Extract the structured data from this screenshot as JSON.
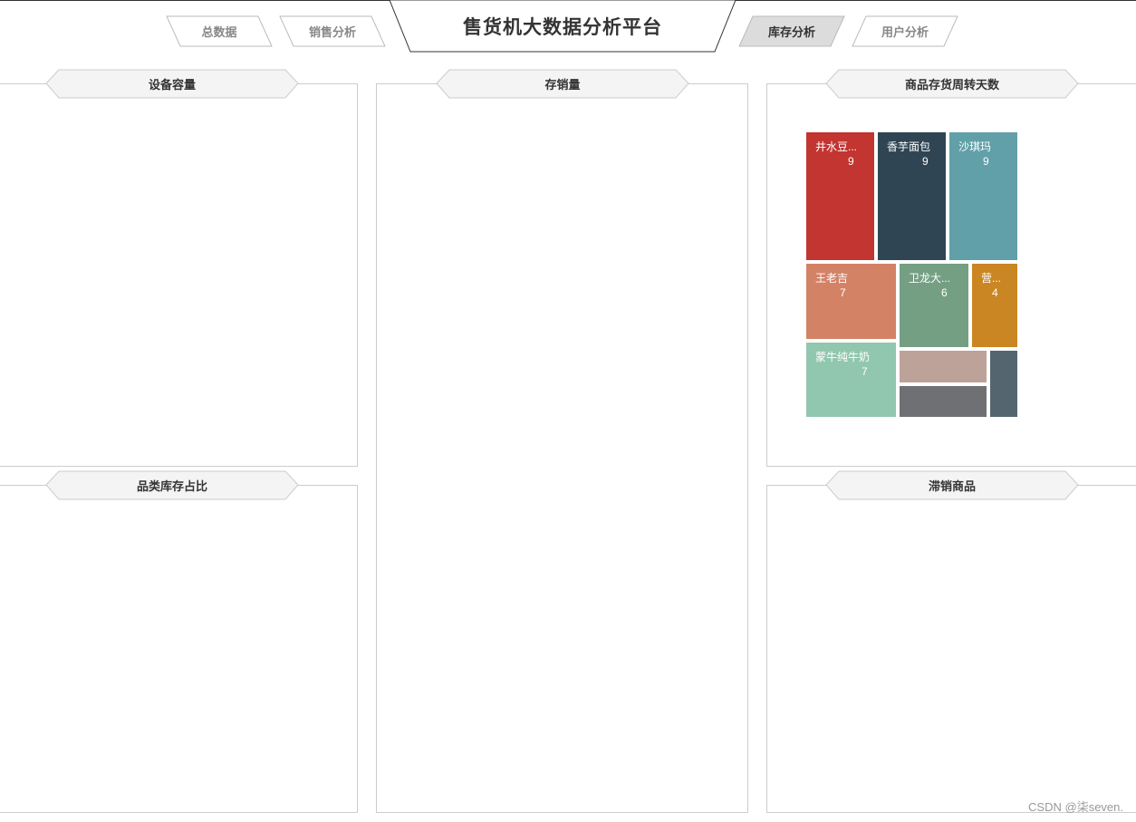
{
  "header": {
    "title": "售货机大数据分析平台",
    "nav": [
      {
        "label": "总数据",
        "active": false
      },
      {
        "label": "销售分析",
        "active": false
      },
      {
        "label": "库存分析",
        "active": true
      },
      {
        "label": "用户分析",
        "active": false
      }
    ]
  },
  "panels": {
    "device_capacity": {
      "title": "设备容量"
    },
    "category_stock": {
      "title": "品类库存占比"
    },
    "stock_sales": {
      "title": "存销量"
    },
    "turnover": {
      "title": "商品存货周转天数"
    },
    "slow_moving": {
      "title": "滞销商品"
    }
  },
  "chart_data": {
    "type": "treemap",
    "items": [
      {
        "label": "井水豆...",
        "value": 9,
        "color": "#c23531"
      },
      {
        "label": "香芋面包",
        "value": 9,
        "color": "#2f4554"
      },
      {
        "label": "沙琪玛",
        "value": 9,
        "color": "#61a0a8"
      },
      {
        "label": "王老吉",
        "value": 7,
        "color": "#d48265"
      },
      {
        "label": "卫龙大...",
        "value": 6,
        "color": "#749f83"
      },
      {
        "label": "营...",
        "value": 4,
        "color": "#ca8622"
      },
      {
        "label": "蒙牛纯牛奶",
        "value": 7,
        "color": "#91c7ae"
      },
      {
        "label": "",
        "value": null,
        "color": "#bda29a"
      },
      {
        "label": "",
        "value": null,
        "color": "#6e7074"
      },
      {
        "label": "",
        "value": null,
        "color": "#546570"
      }
    ]
  },
  "watermark": "CSDN @柒seven."
}
